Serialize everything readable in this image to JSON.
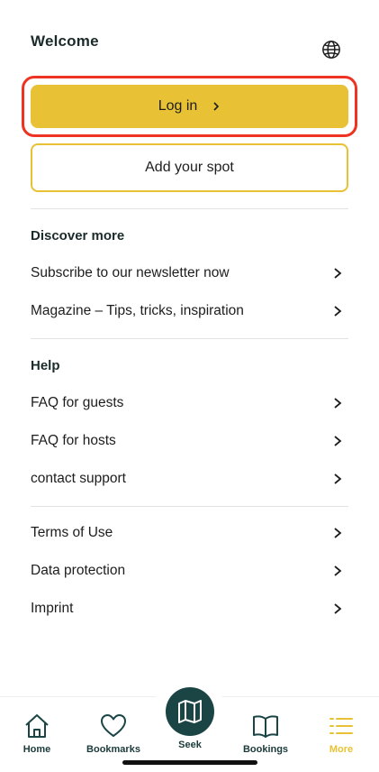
{
  "header": {
    "title": "Welcome",
    "language_icon": "globe-icon"
  },
  "actions": {
    "login_label": "Log in",
    "add_spot_label": "Add your spot"
  },
  "discover": {
    "title": "Discover more",
    "items": [
      {
        "label": "Subscribe to our newsletter now"
      },
      {
        "label": "Magazine – Tips, tricks, inspiration"
      }
    ]
  },
  "help": {
    "title": "Help",
    "items": [
      {
        "label": "FAQ for guests"
      },
      {
        "label": "FAQ for hosts"
      },
      {
        "label": "contact support"
      }
    ]
  },
  "legal": {
    "items": [
      {
        "label": "Terms of Use"
      },
      {
        "label": "Data protection"
      },
      {
        "label": "Imprint"
      }
    ]
  },
  "tabbar": {
    "home": {
      "label": "Home",
      "icon": "home-icon"
    },
    "bookmarks": {
      "label": "Bookmarks",
      "icon": "heart-icon"
    },
    "seek": {
      "label": "Seek",
      "icon": "map-icon"
    },
    "bookings": {
      "label": "Bookings",
      "icon": "book-icon"
    },
    "more": {
      "label": "More",
      "icon": "menu-list-icon",
      "active": true
    }
  },
  "colors": {
    "accent": "#e8c234",
    "primary_dark": "#1b4545",
    "highlight": "#ee3322",
    "divider": "#e2e2e2"
  }
}
